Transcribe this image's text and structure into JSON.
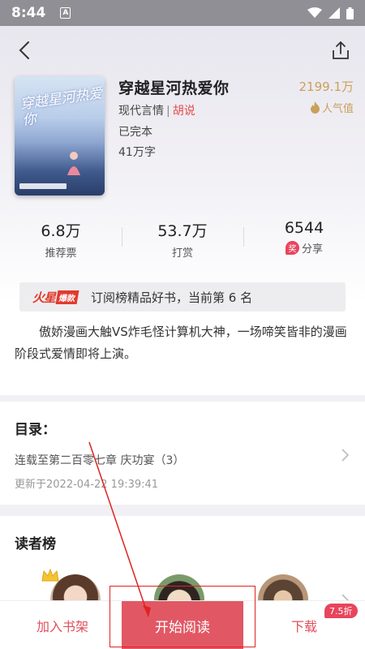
{
  "status_bar": {
    "time": "8:44",
    "notification_icon": "A"
  },
  "nav": {
    "back_icon": "chevron-left-icon",
    "share_icon": "share-icon"
  },
  "book": {
    "cover_title": "穿越星河热爱你",
    "title": "穿越星河热爱你",
    "category": "现代言情",
    "separator": "|",
    "author": "胡说",
    "status": "已完本",
    "word_count": "41万字",
    "popularity_value": "2199.1万",
    "popularity_label": "人气值"
  },
  "stats": [
    {
      "value": "6.8万",
      "label": "推荐票"
    },
    {
      "value": "53.7万",
      "label": "打赏"
    },
    {
      "value": "6544",
      "label": "分享",
      "badge": "奖"
    }
  ],
  "rank_banner": {
    "logo_main": "火星",
    "logo_tag": "爆款",
    "text": "订阅榜精品好书，当前第 6 名"
  },
  "intro": "傲娇漫画大触VS炸毛怪计算机大神，一场啼笑皆非的漫画阶段式爱情即将上演。",
  "catalog": {
    "title": "目录：",
    "latest_chapter": "连载至第二百零七章 庆功宴（3）",
    "updated_at": "更新于2022-04-22 19:39:41"
  },
  "readers": {
    "title": "读者榜"
  },
  "bottom_bar": {
    "add_shelf": "加入书架",
    "start_reading": "开始阅读",
    "download": "下载",
    "discount_badge": "7.5折"
  },
  "colors": {
    "accent": "#e15864",
    "author": "#e64a4a",
    "popularity": "#c9a15a",
    "annotation": "#e02222"
  }
}
